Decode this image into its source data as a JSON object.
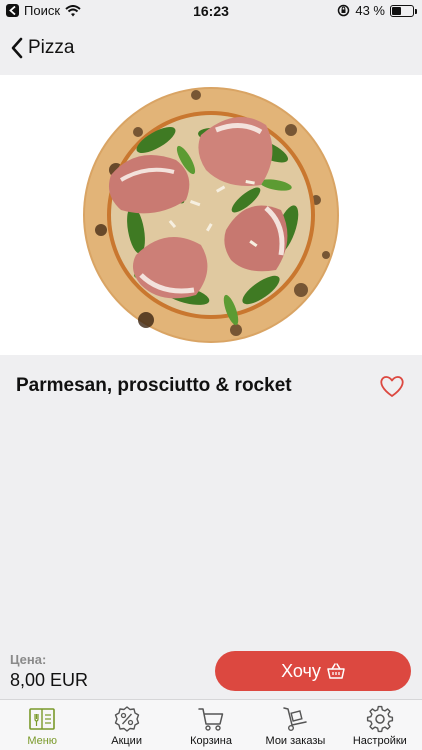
{
  "status_bar": {
    "back_app": "Поиск",
    "time": "16:23",
    "battery_text": "43 %",
    "battery_level": 0.43
  },
  "nav": {
    "back_label": "Pizza"
  },
  "product": {
    "title": "Parmesan, prosciutto & rocket",
    "price_label": "Цена:",
    "price_value": "8,00 EUR",
    "buy_label": "Хочу"
  },
  "tabs": [
    {
      "label": "Меню",
      "icon": "menu-book-icon",
      "active": true
    },
    {
      "label": "Акции",
      "icon": "discount-badge-icon",
      "active": false
    },
    {
      "label": "Корзина",
      "icon": "cart-icon",
      "active": false
    },
    {
      "label": "Мои заказы",
      "icon": "hand-truck-icon",
      "active": false
    },
    {
      "label": "Настройки",
      "icon": "gear-icon",
      "active": false
    }
  ],
  "colors": {
    "accent_red": "#dc4840",
    "active_tab": "#7a9a2a",
    "background": "#efeff1"
  }
}
